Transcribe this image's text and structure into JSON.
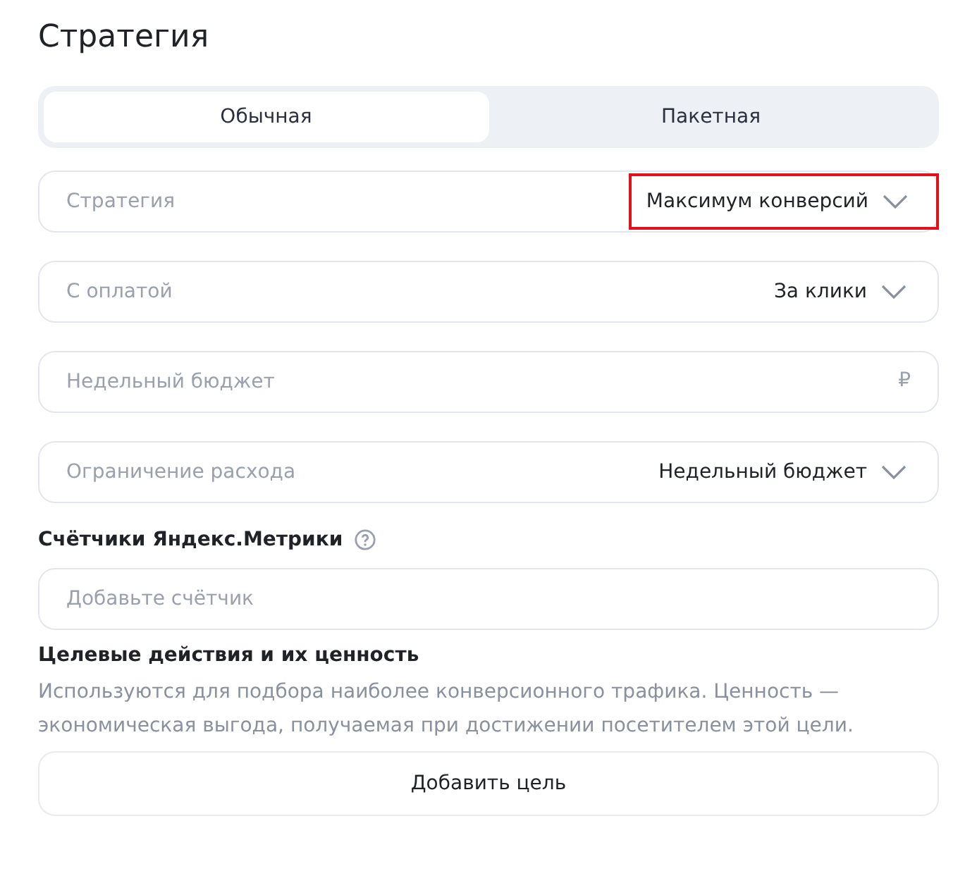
{
  "title": "Стратегия",
  "tabs": [
    {
      "label": "Обычная",
      "selected": true
    },
    {
      "label": "Пакетная",
      "selected": false
    }
  ],
  "fields": [
    {
      "kind": "select",
      "label": "Стратегия",
      "value": "Максимум конверсий",
      "highlighted": true
    },
    {
      "kind": "select",
      "label": "С оплатой",
      "value": "За клики",
      "highlighted": false
    },
    {
      "kind": "input",
      "placeholder": "Недельный бюджет",
      "suffix": "₽"
    },
    {
      "kind": "select",
      "label": "Ограничение расхода",
      "value": "Недельный бюджет",
      "highlighted": false
    }
  ],
  "counters": {
    "label": "Счётчики Яндекс.Метрики",
    "placeholder": "Добавьте счётчик"
  },
  "goals": {
    "heading": "Целевые действия и их ценность",
    "description": "Используются для подбора наиболее конверсионного трафика. Ценность — экономическая выгода, получаемая при достижении посетителем этой цели.",
    "button": "Добавить цель"
  }
}
